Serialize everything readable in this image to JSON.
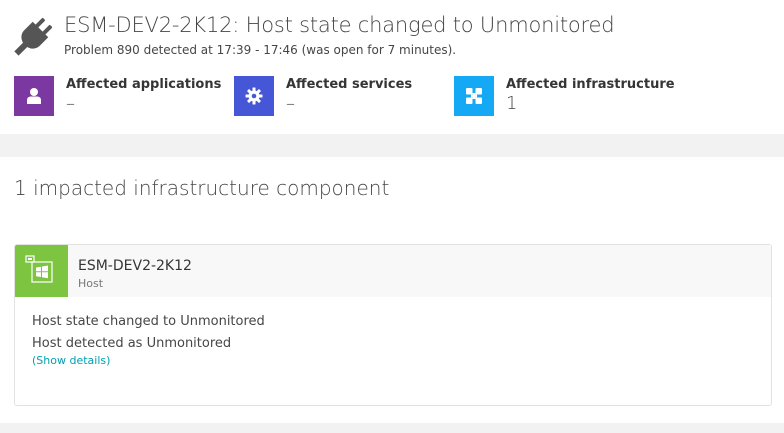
{
  "header": {
    "icon": "plug-icon",
    "title": "ESM-DEV2-2K12: Host state changed to Unmonitored",
    "subtitle": "Problem 890 detected at 17:39 - 17:46 (was open for 7 minutes)."
  },
  "tiles": [
    {
      "label": "Affected applications",
      "value": "–",
      "icon": "user-icon",
      "color": "#7c38a1"
    },
    {
      "label": "Affected services",
      "value": "–",
      "icon": "gear-icon",
      "color": "#4556d7"
    },
    {
      "label": "Affected infrastructure",
      "value": "1",
      "icon": "infrastructure-icon",
      "color": "#14a8f5"
    }
  ],
  "impacted": {
    "title": "1 impacted infrastructure component",
    "component": {
      "name": "ESM-DEV2-2K12",
      "type": "Host",
      "icon": "windows-host-icon",
      "color": "#7dc540",
      "events": [
        "Host state changed to Unmonitored",
        "Host detected as Unmonitored"
      ],
      "details_link": "(Show details)"
    }
  }
}
